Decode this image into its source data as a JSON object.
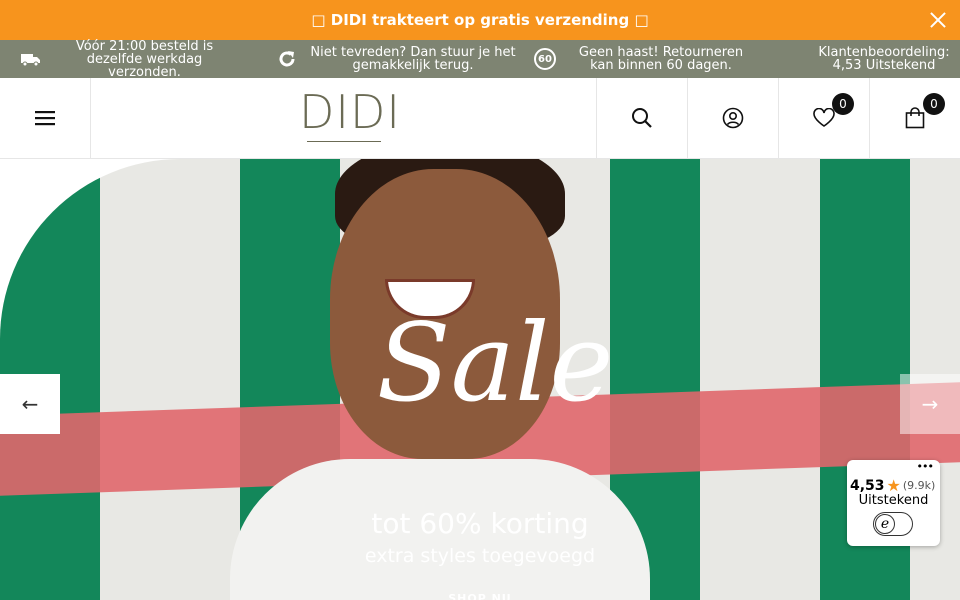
{
  "topbar": {
    "text": "□ DIDI trakteert op gratis verzending □"
  },
  "usp": [
    {
      "icon": "truck-icon",
      "text": "Vóór 21:00 besteld is dezelfde werkdag verzonden."
    },
    {
      "icon": "refresh-icon",
      "text": "Niet tevreden? Dan stuur je het gemakkelijk terug."
    },
    {
      "icon": "sixty-days-icon",
      "text": "Geen haast! Retourneren kan binnen 60 dagen."
    },
    {
      "icon": "",
      "text": "Klantenbeoordeling: 4,53 Uitstekend"
    }
  ],
  "usp_icon_60": "60",
  "header": {
    "logo": "DIDI",
    "wishlist_count": "0",
    "cart_count": "0"
  },
  "hero": {
    "headline": "Sale",
    "subline1": "tot 60% korting",
    "subline2": "extra styles toegevoegd",
    "cta": "SHOP NU",
    "prev": "←",
    "next": "→"
  },
  "review_widget": {
    "score": "4,53",
    "count": "(9.9k)",
    "label": "Uitstekend",
    "dots": "•••",
    "logo_letter": "e"
  },
  "colors": {
    "topbar": "#f7941d",
    "usp_bar": "#7e8472",
    "stripe_green": "#13875a"
  }
}
